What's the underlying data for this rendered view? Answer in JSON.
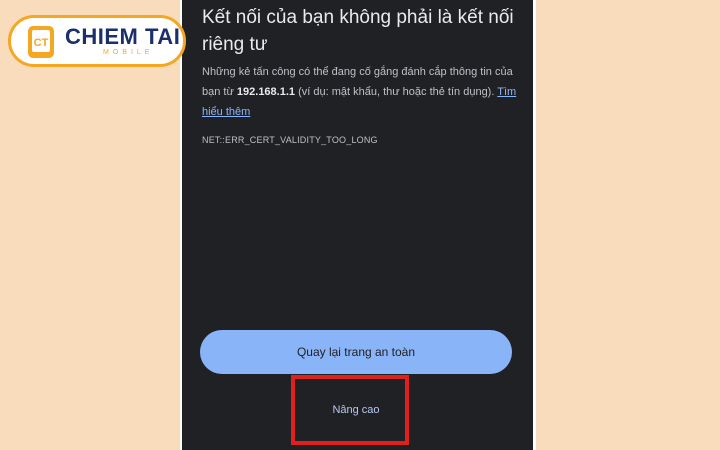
{
  "logo": {
    "mark": "CT",
    "name": "CHIEM TAI",
    "sub": "MOBILE",
    "colors": {
      "orange": "#f5a623",
      "navy": "#1a2f6b"
    }
  },
  "warning": {
    "title": "Kết nối của bạn không phải là kết nối riêng tư",
    "body_prefix": "Những kẻ tấn công có thể đang cố gắng đánh cắp thông tin của bạn từ",
    "host": "192.168.1.1",
    "body_suffix": "(ví dụ: mật khẩu, thư hoặc thẻ tín dụng).",
    "learn_more": "Tìm hiểu thêm",
    "error_code": "NET::ERR_CERT_VALIDITY_TOO_LONG"
  },
  "actions": {
    "back_label": "Quay lại trang an toàn",
    "advanced_label": "Nâng cao"
  },
  "colors": {
    "page_background": "#f8dcbb",
    "screen_background": "#202124",
    "accent_blue": "#8ab4f8",
    "highlight_red": "#e0201d"
  }
}
